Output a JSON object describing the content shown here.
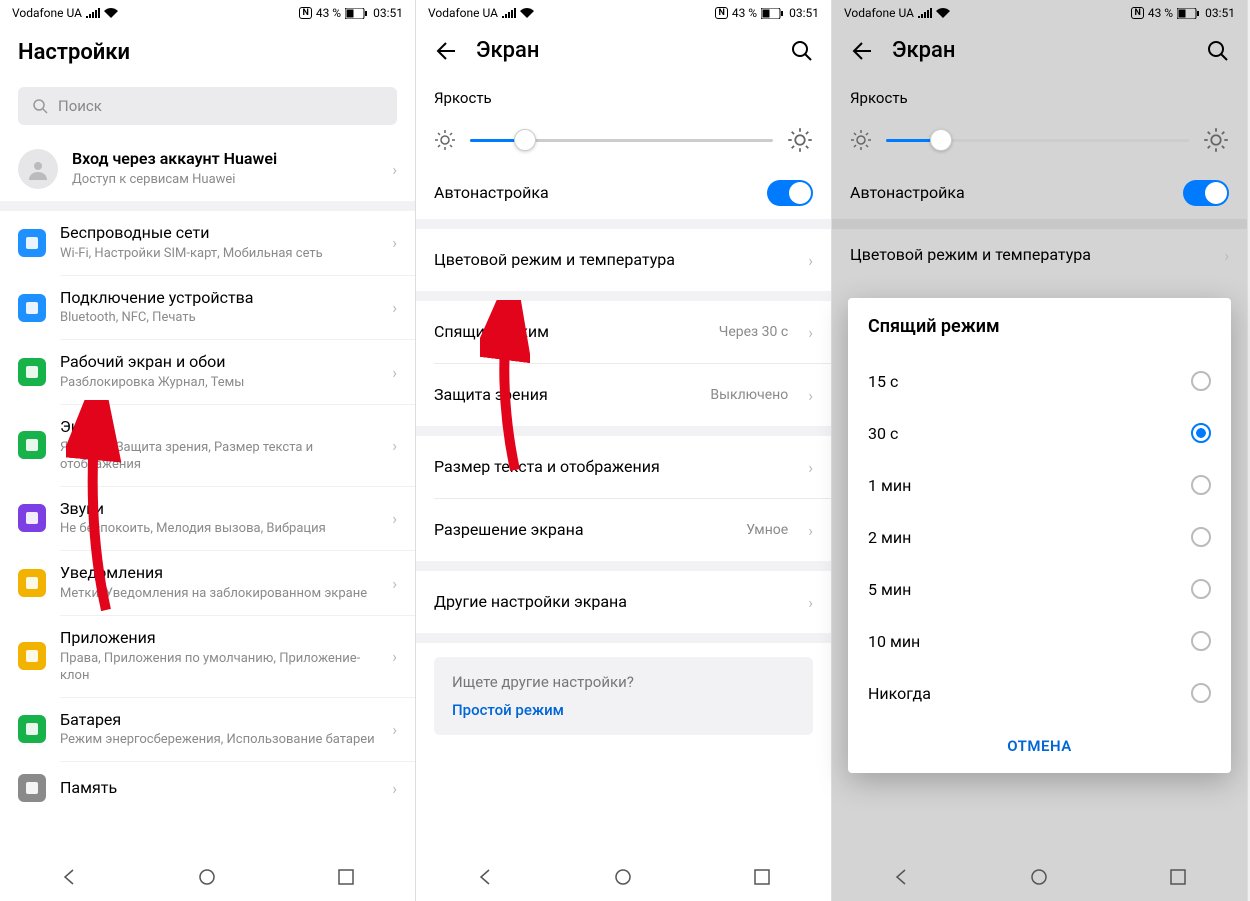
{
  "status": {
    "carrier": "Vodafone UA",
    "battery_pct": "43 %",
    "time": "03:51",
    "nfc": "N"
  },
  "p1": {
    "title": "Настройки",
    "search_placeholder": "Поиск",
    "account": {
      "title": "Вход через аккаунт Huawei",
      "sub": "Доступ к сервисам Huawei"
    },
    "items": [
      {
        "title": "Беспроводные сети",
        "sub": "Wi-Fi, Настройки SIM-карт, Мобильная сеть",
        "color": "#1e90ff"
      },
      {
        "title": "Подключение устройства",
        "sub": "Bluetooth, NFC, Печать",
        "color": "#1e90ff"
      },
      {
        "title": "Рабочий экран и обои",
        "sub": "Разблокировка Журнал, Темы",
        "color": "#18b24b"
      },
      {
        "title": "Экран",
        "sub": "Яркость, Защита зрения, Размер текста и отображения",
        "color": "#18b24b"
      },
      {
        "title": "Звуки",
        "sub": "Не беспокоить, Мелодия вызова, Вибрация",
        "color": "#7b3fe4"
      },
      {
        "title": "Уведомления",
        "sub": "Метки, Уведомления на заблокированном экране",
        "color": "#f2b200"
      },
      {
        "title": "Приложения",
        "sub": "Права, Приложения по умолчанию, Приложение-клон",
        "color": "#f2b200"
      },
      {
        "title": "Батарея",
        "sub": "Режим энергосбережения, Использование батареи",
        "color": "#18b24b"
      },
      {
        "title": "Память",
        "sub": "",
        "color": "#8a8a8a"
      }
    ]
  },
  "p2": {
    "title": "Экран",
    "brightness": "Яркость",
    "auto": "Автонастройка",
    "slider_pct": 18,
    "rows": [
      {
        "title": "Цветовой режим и температура",
        "val": ""
      },
      {
        "title": "Спящий режим",
        "val": "Через 30 с"
      },
      {
        "title": "Защита зрения",
        "val": "Выключено"
      },
      {
        "title": "Размер текста и отображения",
        "val": ""
      },
      {
        "title": "Разрешение экрана",
        "val": "Умное"
      },
      {
        "title": "Другие настройки экрана",
        "val": ""
      }
    ],
    "hint_title": "Ищете другие настройки?",
    "hint_link": "Простой режим"
  },
  "p3": {
    "title": "Экран",
    "brightness": "Яркость",
    "auto": "Автонастройка",
    "slider_pct": 18,
    "color_row": "Цветовой режим и температура",
    "dialog_title": "Спящий режим",
    "options": [
      {
        "label": "15 с",
        "on": false
      },
      {
        "label": "30 с",
        "on": true
      },
      {
        "label": "1 мин",
        "on": false
      },
      {
        "label": "2 мин",
        "on": false
      },
      {
        "label": "5 мин",
        "on": false
      },
      {
        "label": "10 мин",
        "on": false
      },
      {
        "label": "Никогда",
        "on": false
      }
    ],
    "cancel": "ОТМЕНА"
  }
}
